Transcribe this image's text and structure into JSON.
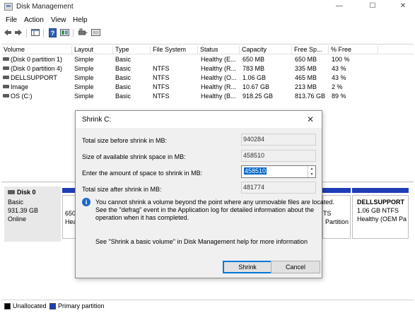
{
  "window": {
    "title": "Disk Management",
    "controls": {
      "minimize": "—",
      "maximize": "☐",
      "close": "✕"
    }
  },
  "menu": {
    "items": [
      "File",
      "Action",
      "View",
      "Help"
    ]
  },
  "toolbar": {
    "icons": [
      "back-arrow-icon",
      "forward-arrow-icon",
      "console-tree-icon",
      "help-icon",
      "properties-icon",
      "connect-disk-icon",
      "list-view-icon"
    ]
  },
  "volume_table": {
    "columns": [
      "Volume",
      "Layout",
      "Type",
      "File System",
      "Status",
      "Capacity",
      "Free Sp...",
      "% Free"
    ],
    "rows": [
      [
        "(Disk 0 partition 1)",
        "Simple",
        "Basic",
        "",
        "Healthy (E...",
        "650 MB",
        "650 MB",
        "100 %"
      ],
      [
        "(Disk 0 partition 4)",
        "Simple",
        "Basic",
        "NTFS",
        "Healthy (R...",
        "783 MB",
        "335 MB",
        "43 %"
      ],
      [
        "DELLSUPPORT",
        "Simple",
        "Basic",
        "NTFS",
        "Healthy (O...",
        "1.06 GB",
        "465 MB",
        "43 %"
      ],
      [
        "Image",
        "Simple",
        "Basic",
        "NTFS",
        "Healthy (R...",
        "10.67 GB",
        "213 MB",
        "2 %"
      ],
      [
        "OS (C:)",
        "Simple",
        "Basic",
        "NTFS",
        "Healthy (B...",
        "918.25 GB",
        "813.76 GB",
        "89 %"
      ]
    ]
  },
  "disk": {
    "name": "Disk 0",
    "type": "Basic",
    "size": "931.39 GB",
    "status": "Online",
    "partitions_visible": {
      "left_fragment_1": "650",
      "left_fragment_2": "Hea",
      "right_fragment_1": "TS",
      "right_fragment_2": "Partition",
      "dellsupport": {
        "name": "DELLSUPPORT",
        "line2": "1.06 GB NTFS",
        "line3": "Healthy (OEM Pa"
      }
    }
  },
  "legend": {
    "unallocated": "Unallocated",
    "primary": "Primary partition",
    "colors": {
      "unallocated": "#000000",
      "primary": "#1f3db5"
    }
  },
  "dialog": {
    "title": "Shrink C:",
    "fields": [
      {
        "label": "Total size before shrink in MB:",
        "value": "940284"
      },
      {
        "label": "Size of available shrink space in MB:",
        "value": "458510"
      },
      {
        "label": "Enter the amount of space to shrink in MB:",
        "value": "458510"
      },
      {
        "label": "Total size after shrink in MB:",
        "value": "481774"
      }
    ],
    "info_lines": [
      "You cannot shrink a volume beyond the point where any unmovable files are located.",
      "See the \"defrag\" event in the Application log for detailed information about the",
      "operation when it has completed."
    ],
    "help_text": "See \"Shrink a basic volume\" in Disk Management help for more information",
    "buttons": {
      "shrink": "Shrink",
      "cancel": "Cancel"
    }
  }
}
